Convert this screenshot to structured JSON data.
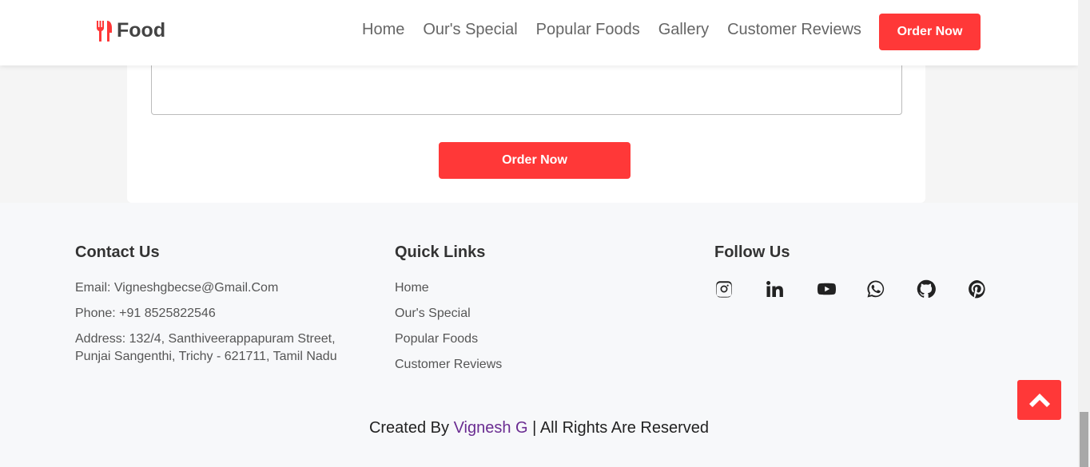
{
  "header": {
    "logo_text": "Food",
    "logo_icon": "utensils-icon",
    "nav": [
      "Home",
      "Our's Special",
      "Popular Foods",
      "Gallery",
      "Customer Reviews"
    ],
    "order_button": "Order Now"
  },
  "form": {
    "submit_label": "Order Now"
  },
  "footer": {
    "contact": {
      "title": "Contact Us",
      "email": "Email: Vigneshgbecse@Gmail.Com",
      "phone": "Phone: +91 8525822546",
      "address_line1": "Address: 132/4, Santhiveerappapuram Street,",
      "address_line2": "Punjai Sangenthi, Trichy - 621711, Tamil Nadu"
    },
    "links": {
      "title": "Quick Links",
      "items": [
        "Home",
        "Our's Special",
        "Popular Foods",
        "Customer Reviews"
      ]
    },
    "follow": {
      "title": "Follow Us",
      "icons": [
        "instagram-icon",
        "linkedin-icon",
        "youtube-icon",
        "whatsapp-icon",
        "github-icon",
        "pinterest-icon"
      ]
    },
    "credit": {
      "prefix": "Created By",
      "author": "Vignesh G",
      "suffix": "| All Rights Are Reserved"
    }
  },
  "colors": {
    "accent": "#ff3838",
    "author_link": "#6a2c91"
  }
}
